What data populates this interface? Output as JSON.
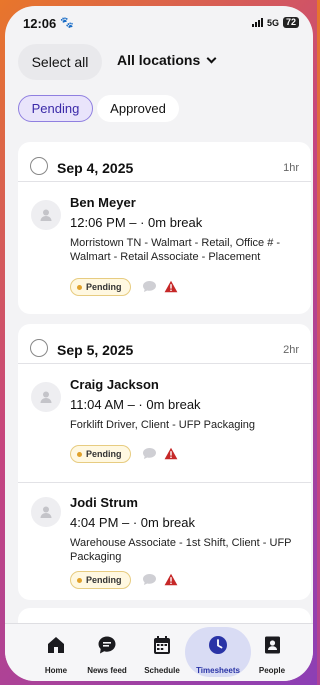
{
  "status_bar": {
    "time": "12:06",
    "network": "5G",
    "battery": "72"
  },
  "header": {
    "select_all": "Select all",
    "locations": "All locations"
  },
  "tabs": [
    {
      "label": "Pending",
      "active": true
    },
    {
      "label": "Approved",
      "active": false
    }
  ],
  "days": [
    {
      "date": "Sep 4, 2025",
      "hours": "1hr",
      "entries": [
        {
          "name": "Ben Meyer",
          "shift": "12:06 PM –  · 0m break",
          "description": "Morristown TN - Walmart - Retail, Office # - Walmart - Retail Associate - Placement",
          "status": "Pending"
        }
      ]
    },
    {
      "date": "Sep 5, 2025",
      "hours": "2hr",
      "entries": [
        {
          "name": "Craig Jackson",
          "shift": "11:04 AM –  · 0m break",
          "description": "Forklift Driver, Client - UFP Packaging",
          "status": "Pending"
        },
        {
          "name": "Jodi Strum",
          "shift": "4:04 PM –  · 0m break",
          "description": "Warehouse Associate - 1st Shift, Client - UFP Packaging",
          "status": "Pending"
        }
      ]
    }
  ],
  "nav": [
    {
      "label": "Home",
      "icon": "home-icon"
    },
    {
      "label": "News feed",
      "icon": "chat-icon"
    },
    {
      "label": "Schedule",
      "icon": "calendar-icon"
    },
    {
      "label": "Timesheets",
      "icon": "clock-icon",
      "active": true
    },
    {
      "label": "People",
      "icon": "contact-book-icon"
    }
  ],
  "colors": {
    "accent": "#2a34a6",
    "pending_bg": "#fff8e1",
    "warning": "#c62828",
    "tab_active_bg": "#e9e4fb"
  }
}
